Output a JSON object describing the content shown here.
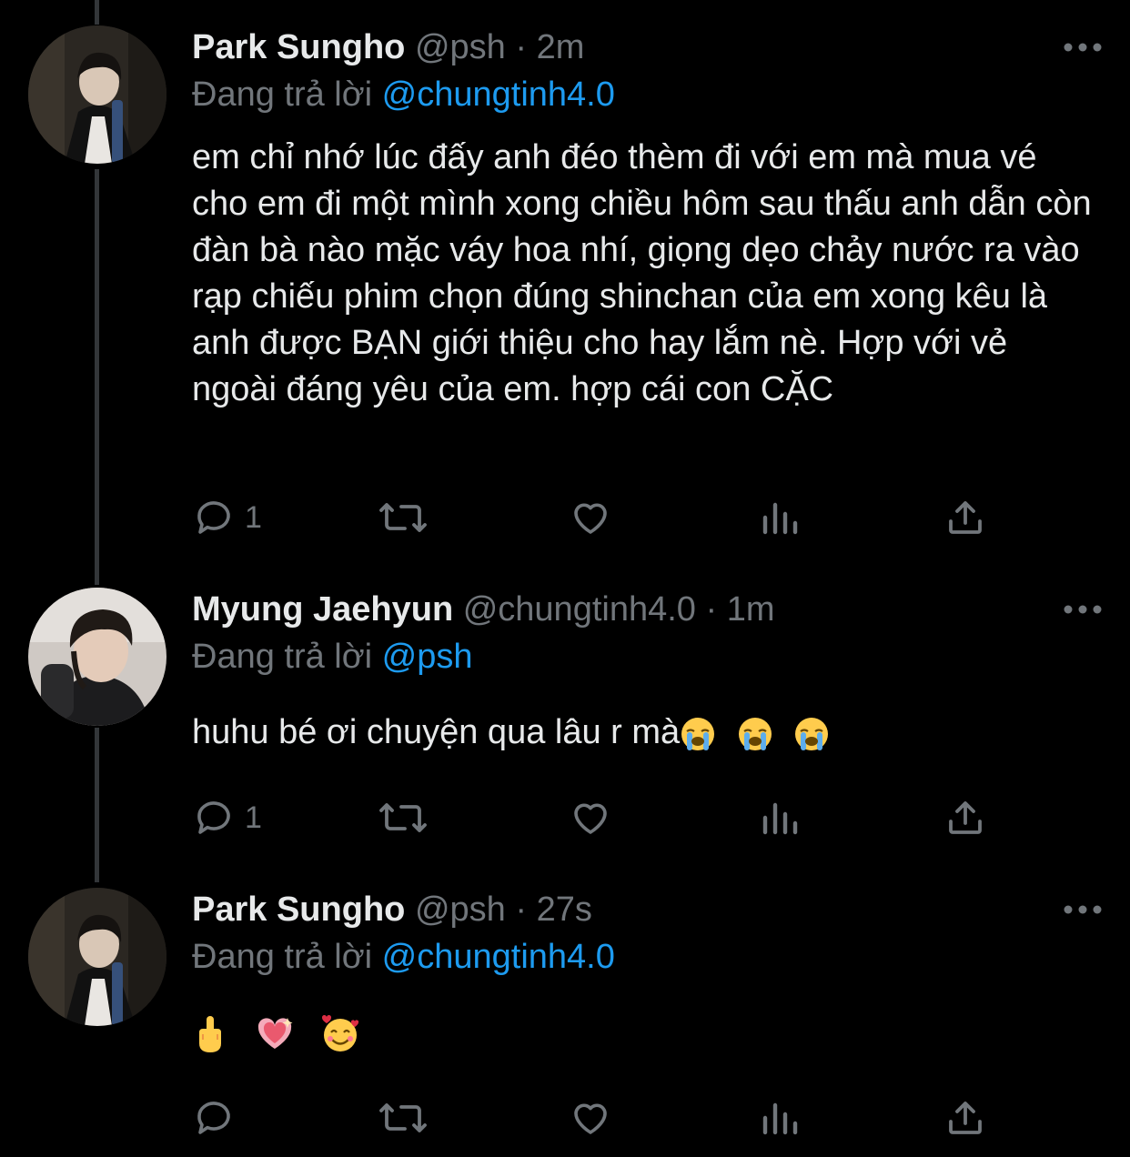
{
  "tweets": [
    {
      "name": "Park Sungho",
      "handle": "@psh",
      "dot": "·",
      "time": "2m",
      "replying_label": "Đang trả lời",
      "replying_to": "@chungtinh4.0",
      "text": "em chỉ nhớ lúc đấy anh đéo thèm đi với em mà mua vé cho em đi một mình xong chiều hôm sau thấu anh dẫn còn đàn bà nào mặc váy hoa nhí, giọng dẹo chảy nước ra vào rạp chiếu phim chọn đúng shinchan của em xong kêu là anh được BẠN giới thiệu cho hay lắm nè. Hợp với vẻ ngoài đáng yêu của em. hợp cái con CẶC",
      "reply_count": "1"
    },
    {
      "name": "Myung Jaehyun",
      "handle": "@chungtinh4.0",
      "dot": "·",
      "time": "1m",
      "replying_label": "Đang trả lời",
      "replying_to": "@psh",
      "text": "huhu bé ơi chuyện qua lâu r mà",
      "emojis": [
        "loudly-crying-face",
        "loudly-crying-face",
        "loudly-crying-face"
      ],
      "reply_count": "1"
    },
    {
      "name": "Park Sungho",
      "handle": "@psh",
      "dot": "·",
      "time": "27s",
      "replying_label": "Đang trả lời",
      "replying_to": "@chungtinh4.0",
      "text": "",
      "emojis": [
        "middle-finger",
        "sparkling-heart",
        "smiling-face-with-hearts"
      ],
      "reply_count": ""
    }
  ],
  "icons": {
    "more": "more-dots-icon",
    "reply": "reply-icon",
    "retweet": "retweet-icon",
    "like": "like-icon",
    "views": "views-icon",
    "share": "share-icon"
  },
  "colors": {
    "background": "#000000",
    "text": "#e7e9ea",
    "secondary": "#71767b",
    "mention": "#1d9bf0",
    "thread_line": "#333639"
  }
}
